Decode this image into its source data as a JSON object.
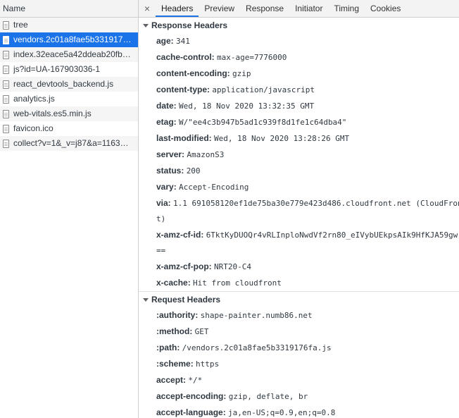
{
  "left": {
    "column_header": "Name",
    "files": [
      {
        "name": "tree"
      },
      {
        "name": "vendors.2c01a8fae5b331917…"
      },
      {
        "name": "index.32eace5a42ddeab20fb…"
      },
      {
        "name": "js?id=UA-167903036-1"
      },
      {
        "name": "react_devtools_backend.js"
      },
      {
        "name": "analytics.js"
      },
      {
        "name": "web-vitals.es5.min.js"
      },
      {
        "name": "favicon.ico"
      },
      {
        "name": "collect?v=1&_v=j87&a=1163…"
      }
    ]
  },
  "tabs": {
    "close": "×",
    "items": [
      "Headers",
      "Preview",
      "Response",
      "Initiator",
      "Timing",
      "Cookies"
    ]
  },
  "response_headers": {
    "title": "Response Headers",
    "rows": [
      {
        "name": "age:",
        "value": "341"
      },
      {
        "name": "cache-control:",
        "value": "max-age=7776000"
      },
      {
        "name": "content-encoding:",
        "value": "gzip"
      },
      {
        "name": "content-type:",
        "value": "application/javascript"
      },
      {
        "name": "date:",
        "value": "Wed, 18 Nov 2020 13:32:35 GMT"
      },
      {
        "name": "etag:",
        "value": "W/\"ee4c3b947b5ad1c939f8d1fe1c64dba4\""
      },
      {
        "name": "last-modified:",
        "value": "Wed, 18 Nov 2020 13:28:26 GMT"
      },
      {
        "name": "server:",
        "value": "AmazonS3"
      },
      {
        "name": "status:",
        "value": "200"
      },
      {
        "name": "vary:",
        "value": "Accept-Encoding"
      },
      {
        "name": "via:",
        "value": "1.1 691058120ef1de75ba30e779e423d486.cloudfront.net (CloudFron"
      },
      {
        "name": "x-amz-cf-id:",
        "value": "6TktKyDUOQr4vRLInploNwdVf2rn80_eIVybUEkpsAIk9HfKJA59gw"
      },
      {
        "name": "x-amz-cf-pop:",
        "value": "NRT20-C4"
      },
      {
        "name": "x-cache:",
        "value": "Hit from cloudfront"
      }
    ],
    "via_wrap": "t)",
    "cfid_wrap": "=="
  },
  "request_headers": {
    "title": "Request Headers",
    "rows": [
      {
        "name": ":authority:",
        "value": "shape-painter.numb86.net"
      },
      {
        "name": ":method:",
        "value": "GET"
      },
      {
        "name": ":path:",
        "value": "/vendors.2c01a8fae5b3319176fa.js"
      },
      {
        "name": ":scheme:",
        "value": "https"
      },
      {
        "name": "accept:",
        "value": "*/*"
      },
      {
        "name": "accept-encoding:",
        "value": "gzip, deflate, br"
      },
      {
        "name": "accept-language:",
        "value": "ja,en-US;q=0.9,en;q=0.8"
      }
    ]
  },
  "colors": {
    "selected": "#1a73e8",
    "active_tab_underline": "#1a73e8"
  }
}
